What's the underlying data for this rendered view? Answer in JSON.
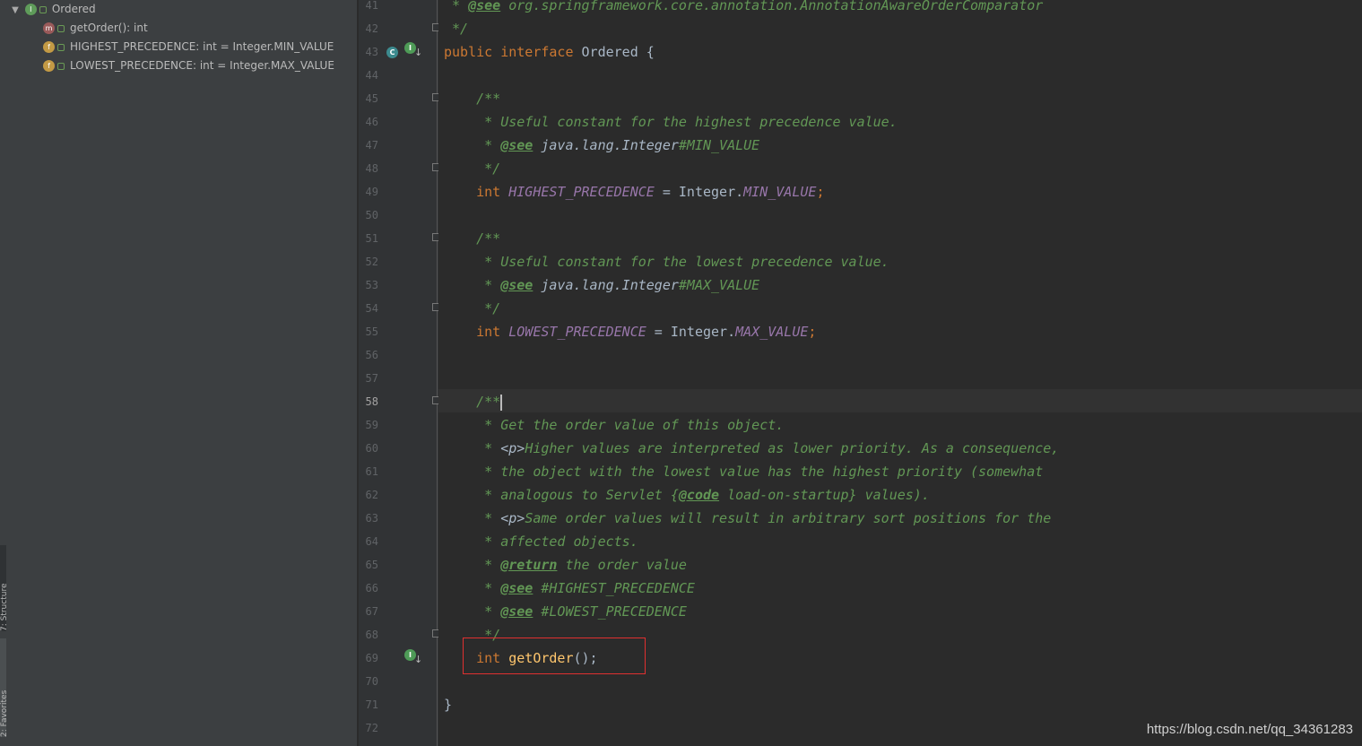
{
  "structure": {
    "root": {
      "label": "Ordered",
      "icon": "interface-icon",
      "badge": "I"
    },
    "items": [
      {
        "label": "getOrder(): int",
        "icon": "method-icon",
        "badge": "m"
      },
      {
        "label": "HIGHEST_PRECEDENCE: int = Integer.MIN_VALUE",
        "icon": "field-icon",
        "badge": "f"
      },
      {
        "label": "LOWEST_PRECEDENCE: int = Integer.MAX_VALUE",
        "icon": "field-icon",
        "badge": "f"
      }
    ]
  },
  "toolstrip": {
    "structure_tab": "7: Structure",
    "favorites_tab": "2: Favorites"
  },
  "editor": {
    "line_numbers": [
      "41",
      "42",
      "43",
      "44",
      "45",
      "46",
      "47",
      "48",
      "49",
      "50",
      "51",
      "52",
      "53",
      "54",
      "55",
      "56",
      "57",
      "58",
      "59",
      "60",
      "61",
      "62",
      "63",
      "64",
      "65",
      "66",
      "67",
      "68",
      "69",
      "70",
      "71",
      "72"
    ],
    "current_line": "58",
    "code": {
      "l41_star": " * ",
      "l41_tag": "@see",
      "l41_text": " org.springframework.core.annotation.AnnotationAwareOrderComparator",
      "l42": " */",
      "l43_kw": "public interface",
      "l43_name": " Ordered {",
      "l45": "    /**",
      "l46": "     * Useful constant for the highest precedence value.",
      "l47_star": "     * ",
      "l47_tag": "@see",
      "l47_ref": " java.lang.Integer",
      "l47_member": "#MIN_VALUE",
      "l48": "     */",
      "l49_type": "    int ",
      "l49_field": "HIGHEST_PRECEDENCE",
      "l49_eq": " = Integer.",
      "l49_const": "MIN_VALUE",
      "l49_semi": ";",
      "l51": "    /**",
      "l52": "     * Useful constant for the lowest precedence value.",
      "l53_star": "     * ",
      "l53_tag": "@see",
      "l53_ref": " java.lang.Integer",
      "l53_member": "#MAX_VALUE",
      "l54": "     */",
      "l55_type": "    int ",
      "l55_field": "LOWEST_PRECEDENCE",
      "l55_eq": " = Integer.",
      "l55_const": "MAX_VALUE",
      "l55_semi": ";",
      "l58": "    /**",
      "l59": "     * Get the order value of this object.",
      "l60_a": "     * ",
      "l60_p": "<p>",
      "l60_b": "Higher values are interpreted as lower priority. As a consequence,",
      "l61": "     * the object with the lowest value has the highest priority (somewhat",
      "l62_a": "     * analogous to Servlet {",
      "l62_tag": "@code",
      "l62_b": " load-on-startup} values).",
      "l63_a": "     * ",
      "l63_p": "<p>",
      "l63_b": "Same order values will result in arbitrary sort positions for the",
      "l64": "     * affected objects.",
      "l65_star": "     * ",
      "l65_tag": "@return",
      "l65_text": " the order value",
      "l66_star": "     * ",
      "l66_tag": "@see",
      "l66_text": " #HIGHEST_PRECEDENCE",
      "l67_star": "     * ",
      "l67_tag": "@see",
      "l67_text": " #LOWEST_PRECEDENCE",
      "l68": "     */",
      "l69_type": "    int ",
      "l69_method": "getOrder",
      "l69_rest": "();",
      "l71": "}"
    }
  },
  "watermark": "https://blog.csdn.net/qq_34361283",
  "colors": {
    "keyword": "#cc7832",
    "comment": "#629755",
    "field": "#9876aa",
    "method": "#ffc66d",
    "highlight_box": "#e03030"
  }
}
